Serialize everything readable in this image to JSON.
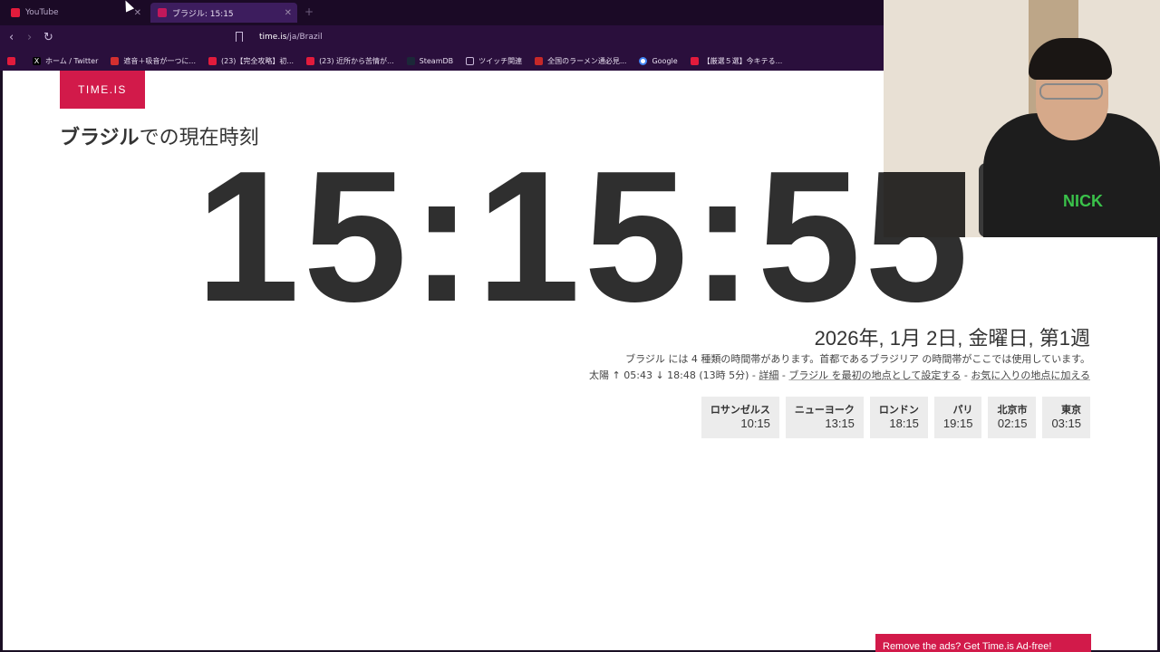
{
  "browser": {
    "tabs": [
      {
        "title": "YouTube"
      },
      {
        "title": "ブラジル: 15:15"
      }
    ],
    "new_tab": "+",
    "url_host": "time.is",
    "url_path": "/ja/Brazil",
    "bookmarks": [
      {
        "label": "",
        "color": "#e21b3c"
      },
      {
        "label": "ホーム / Twitter",
        "color": "#000000"
      },
      {
        "label": "遮音＋吸音が一つに...",
        "color": "#d32f2f"
      },
      {
        "label": "(23)【完全攻略】初...",
        "color": "#e21b3c"
      },
      {
        "label": "(23) 近所から苦情が...",
        "color": "#e21b3c"
      },
      {
        "label": "SteamDB",
        "color": "#1b2838"
      },
      {
        "label": "ツイッチ関連",
        "color": "#c8b8d8"
      },
      {
        "label": "全国のラーメン通必見...",
        "color": "#c62828"
      },
      {
        "label": "Google",
        "color": "#4285f4"
      },
      {
        "label": "【厳選５選】今キテる...",
        "color": "#e21b3c"
      }
    ]
  },
  "page": {
    "logo": "TIME.IS",
    "heading_bold": "ブラジル",
    "heading_rest": "での現在時刻",
    "clock": "15:15:55",
    "date": "2026年, 1月 2日, 金曜日, 第1週",
    "info_line1": "ブラジル には 4 種類の時間帯があります。首都であるブラジリア の時間帯がここでは使用しています。",
    "info_sun": "太陽 ↑ 05:43 ↓ 18:48 (13時 5分) -",
    "link_details": "詳細",
    "sep1": "-",
    "link_set_first": "ブラジル を最初の地点として設定する",
    "sep2": "-",
    "link_favorite": "お気に入りの地点に加える",
    "cities": [
      {
        "name": "ロサンゼルス",
        "time": "10:15"
      },
      {
        "name": "ニューヨーク",
        "time": "13:15"
      },
      {
        "name": "ロンドン",
        "time": "18:15"
      },
      {
        "name": "パリ",
        "time": "19:15"
      },
      {
        "name": "北京市",
        "time": "02:15"
      },
      {
        "name": "東京",
        "time": "03:15"
      }
    ],
    "ad_button": "Remove the ads? Get Time.is Ad-free!"
  },
  "webcam": {
    "shirt_text": "NICK"
  },
  "colors": {
    "brand": "#d21a4a",
    "chrome_bg": "#2a0f3c",
    "clock_text": "#2f2f2f"
  }
}
